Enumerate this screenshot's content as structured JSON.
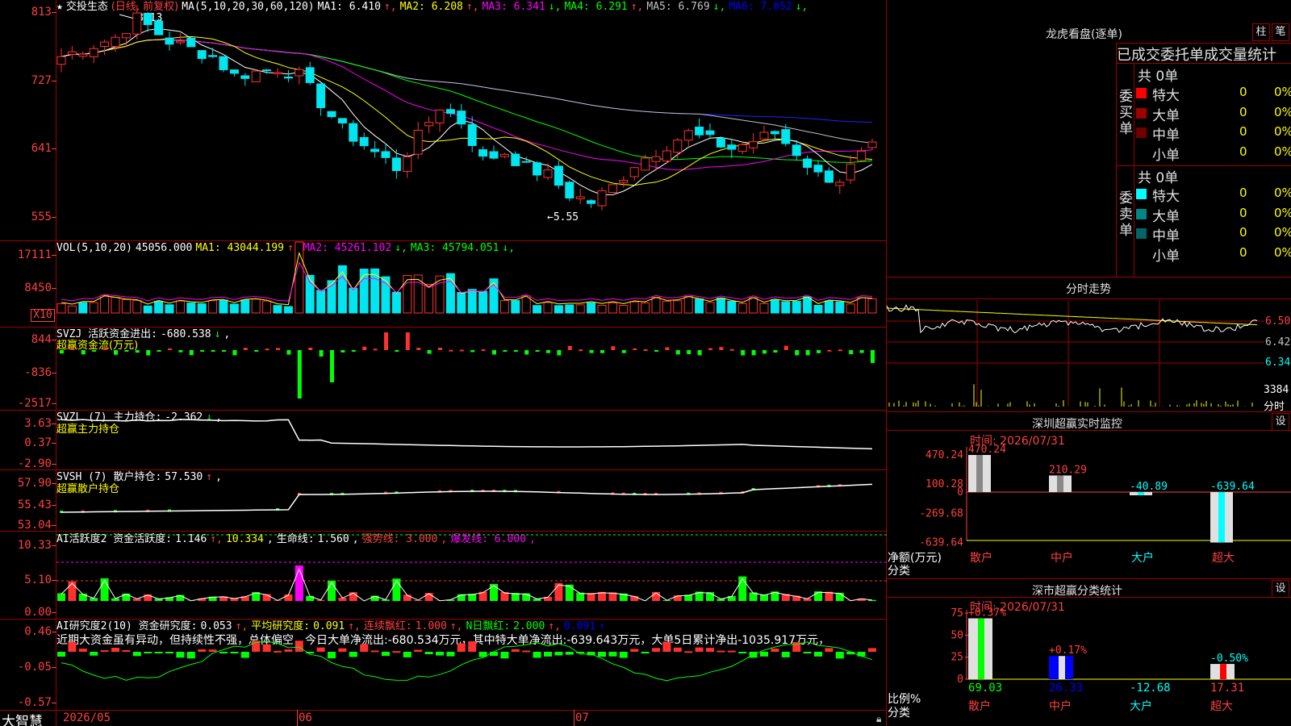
{
  "app": {
    "brand": "大智慧"
  },
  "kline": {
    "stock_name": "交投生态",
    "period": "(日线, 前复权)",
    "ma_header": "MA(5,10,20,30,60,120)",
    "ma": [
      {
        "label": "MA1:",
        "value": "6.410",
        "arrow": "↑",
        "color": "#ffffff"
      },
      {
        "label": "MA2:",
        "value": "6.208",
        "arrow": "↑",
        "color": "#ffff00"
      },
      {
        "label": "MA3:",
        "value": "6.341",
        "arrow": "↓",
        "color": "#ff00ff"
      },
      {
        "label": "MA4:",
        "value": "6.291",
        "arrow": "↑",
        "color": "#00ff00"
      },
      {
        "label": "MA5:",
        "value": "6.769",
        "arrow": "↓",
        "color": "#c0c0c0"
      },
      {
        "label": "MA6:",
        "value": "7.052",
        "arrow": "↓",
        "color": "#0000ff"
      }
    ],
    "y_ticks": [
      "813",
      "727",
      "641",
      "555"
    ],
    "high_label": "8.13",
    "low_label": "←5.55"
  },
  "volume": {
    "header": "VOL(5,10,20)",
    "value": "45056.000",
    "ma": [
      {
        "label": "MA1:",
        "value": "43044.199",
        "arrow": "↑",
        "color": "#ffff00"
      },
      {
        "label": "MA2:",
        "value": "45261.102",
        "arrow": "↓",
        "color": "#ff00ff"
      },
      {
        "label": "MA3:",
        "value": "45794.051",
        "arrow": "↓",
        "color": "#00ff00"
      }
    ],
    "y_ticks": [
      "17111",
      "8450"
    ],
    "unit": "X10"
  },
  "svzj": {
    "header": "SVZJ  活跃资金进出:",
    "value": "-680.538",
    "arrow": "↓",
    "sub": "超赢资金流(万元)",
    "y_ticks": [
      "844",
      "-836",
      "-2517"
    ]
  },
  "svzl": {
    "header": "SVZL (7) 主力持仓:",
    "value": "-2.362",
    "arrow": "↓",
    "sub": "超赢主力持仓",
    "y_ticks": [
      "3.63",
      "0.37",
      "-2.90"
    ]
  },
  "svsh": {
    "header": "SVSH (7) 散户持仓:",
    "value": "57.530",
    "arrow": "↑",
    "sub": "超赢散户持仓",
    "y_ticks": [
      "57.90",
      "55.43",
      "53.04"
    ]
  },
  "ai_active": {
    "header": "AI活跃度2 资金活跃度:",
    "value": "1.146",
    "v2": "10.334",
    "life_label": "生命线:",
    "life_value": "1.560",
    "strong": "强势线: 3.000",
    "burst": "爆发线: 6.000",
    "y_ticks": [
      "10.33",
      "5.10",
      "0.00"
    ]
  },
  "ai_research": {
    "header": "AI研究度2(10) 资金研究度:",
    "value": "0.053",
    "avg_label": "平均研究度:",
    "avg_value": "0.091",
    "cont_label": "连续飘红:",
    "cont_value": "1.000",
    "nday_label": "N日飘红:",
    "nday_value": "2.000",
    "last_value": "0.091",
    "comment": "近期大资金虽有异动，但持续性不强，总体偏空，今日大单净流出:-680.534万元，其中特大单净流出:-639.643万元，大单5日累计净出-1035.917万元，",
    "y_ticks": [
      "0.46",
      "-0.05",
      "-0.57"
    ]
  },
  "date_axis": [
    "2026/05",
    "06",
    "07"
  ],
  "right": {
    "dragon_title": "龙虎看盘(逐单)",
    "btn_bar": "柱",
    "btn_pen": "笔",
    "tabs": [
      "已成交委托单",
      "成交量统计"
    ],
    "buy_label": "委买单",
    "sell_label": "委卖单",
    "buy_total": "共 0单",
    "sell_total": "共 0单",
    "buy_rows": [
      {
        "label": "特大",
        "count": "0",
        "pct": "0%",
        "color": "#ff0000"
      },
      {
        "label": "大单",
        "count": "0",
        "pct": "0%",
        "color": "#a00000"
      },
      {
        "label": "中单",
        "count": "0",
        "pct": "0%",
        "color": "#700000"
      },
      {
        "label": "小单",
        "count": "0",
        "pct": "0%",
        "color": ""
      }
    ],
    "sell_rows": [
      {
        "label": "特大",
        "count": "0",
        "pct": "0%",
        "color": "#00ffff"
      },
      {
        "label": "大单",
        "count": "0",
        "pct": "0%",
        "color": "#008888"
      },
      {
        "label": "中单",
        "count": "0",
        "pct": "0%",
        "color": "#006666"
      },
      {
        "label": "小单",
        "count": "0",
        "pct": "0%",
        "color": ""
      }
    ],
    "intraday_title": "分时走势",
    "intraday_y": [
      "6.50",
      "6.42",
      "6.34"
    ],
    "intraday_vol": "3384",
    "intraday_vol_label": "分时",
    "sz_title": "深圳超赢实时监控",
    "sz_btn": "设",
    "sz_time": "时间: 2026/07/31",
    "sz_y": [
      "470.24",
      "100.28",
      "0",
      "-269.68",
      "-639.64"
    ],
    "sz_bar_labels": [
      "470.24",
      "210.29",
      "-40.89",
      "-639.64"
    ],
    "sz_y_unit": "净额(万元)",
    "sz_cat_label": "分类",
    "sz_categories": [
      "散户",
      "中户",
      "大户",
      "超大"
    ],
    "sc_title": "深市超赢分类统计",
    "sc_btn": "设",
    "sc_time": "时间: 2026/07/31",
    "sc_y": [
      "75",
      "50",
      "25",
      "0"
    ],
    "sc_bar_top": [
      "+0.37%",
      "+0.17%",
      "-0.50%"
    ],
    "sc_bottom_values": [
      "69.03",
      "26.33",
      "-12.68",
      "17.31"
    ],
    "sc_y_unit": "比例%",
    "sc_cat_label": "分类",
    "sc_categories": [
      "散户",
      "中户",
      "大户",
      "超大"
    ]
  },
  "colors": {
    "up": "#ff3030",
    "down": "#00e5ee",
    "grid": "#a00000",
    "volgreen": "#00ff00"
  }
}
